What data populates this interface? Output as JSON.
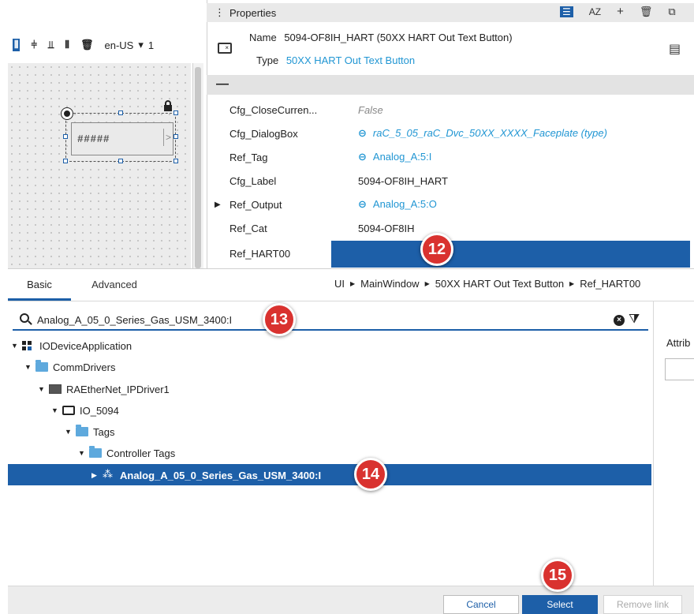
{
  "canvas": {
    "locale": "en-US",
    "locale_suffix": "1",
    "widget_text": "#####",
    "widget_chevron": ">"
  },
  "properties": {
    "title": "Properties",
    "sort_label": "AZ",
    "name_label": "Name",
    "name_value": "5094-OF8IH_HART (50XX HART Out Text Button)",
    "type_label": "Type",
    "type_value": "50XX HART Out Text Button",
    "collapse": "—",
    "rows": [
      {
        "name": "Cfg_CloseCurren...",
        "value": "False",
        "style": "muted"
      },
      {
        "name": "Cfg_DialogBox",
        "value": "raC_5_05_raC_Dvc_50XX_XXXX_Faceplate (type)",
        "style": "link-italic"
      },
      {
        "name": "Ref_Tag",
        "value": "Analog_A:5:I",
        "style": "link"
      },
      {
        "name": "Cfg_Label",
        "value": "5094-OF8IH_HART",
        "style": "plain"
      },
      {
        "name": "Ref_Output",
        "value": "Analog_A:5:O",
        "style": "link"
      },
      {
        "name": "Ref_Cat",
        "value": "5094-OF8IH",
        "style": "plain"
      },
      {
        "name": "Ref_HART00",
        "value": "",
        "style": "selected"
      }
    ]
  },
  "dialog": {
    "tabs": [
      "Basic",
      "Advanced"
    ],
    "breadcrumb": [
      "UI",
      "MainWindow",
      "50XX HART Out Text Button",
      "Ref_HART00"
    ],
    "search_value": "Analog_A_05_0_Series_Gas_USM_3400:I",
    "attrib_label": "Attrib",
    "tree": [
      {
        "label": "IODeviceApplication",
        "icon": "app"
      },
      {
        "label": "CommDrivers",
        "icon": "folder"
      },
      {
        "label": "RAEtherNet_IPDriver1",
        "icon": "driver"
      },
      {
        "label": "IO_5094",
        "icon": "station"
      },
      {
        "label": "Tags",
        "icon": "folder"
      },
      {
        "label": "Controller Tags",
        "icon": "folder"
      },
      {
        "label": "Analog_A_05_0_Series_Gas_USM_3400:I",
        "icon": "tag",
        "selected": true
      }
    ],
    "buttons": {
      "cancel": "Cancel",
      "select": "Select",
      "remove": "Remove link"
    }
  },
  "callouts": [
    "12",
    "13",
    "14",
    "15"
  ],
  "colors": {
    "accent": "#1d5fa8",
    "link": "#2196d3",
    "badge": "#d9322f"
  }
}
